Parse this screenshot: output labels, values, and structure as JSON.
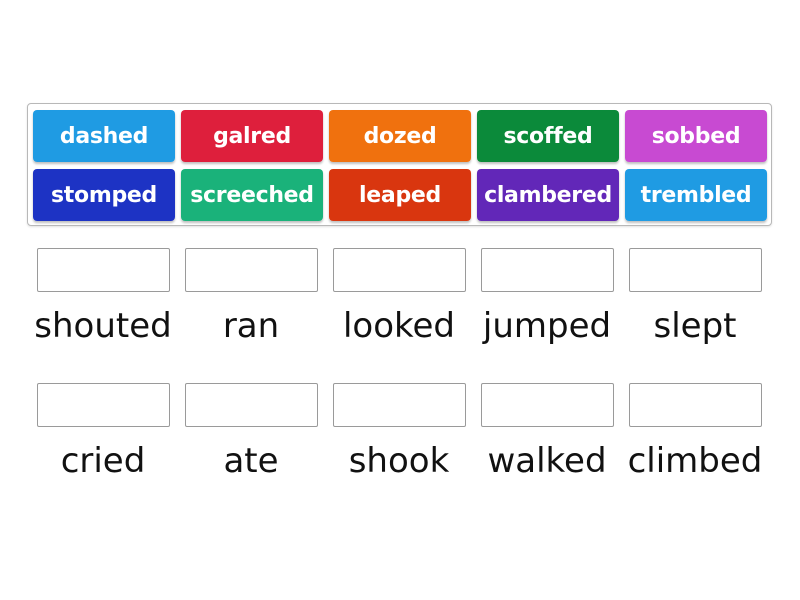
{
  "activity": {
    "tiles": [
      {
        "text": "dashed",
        "color": "#1f9be3"
      },
      {
        "text": "galred",
        "color": "#de1f3c"
      },
      {
        "text": "dozed",
        "color": "#f0710e"
      },
      {
        "text": "scoffed",
        "color": "#0b8a3a"
      },
      {
        "text": "sobbed",
        "color": "#c84ad2"
      },
      {
        "text": "stomped",
        "color": "#1d33c4"
      },
      {
        "text": "screeched",
        "color": "#1ab27a"
      },
      {
        "text": "leaped",
        "color": "#d9360f"
      },
      {
        "text": "clambered",
        "color": "#6227b8"
      },
      {
        "text": "trembled",
        "color": "#1f9be3"
      }
    ],
    "targets": [
      {
        "label": "shouted",
        "value": ""
      },
      {
        "label": "ran",
        "value": ""
      },
      {
        "label": "looked",
        "value": ""
      },
      {
        "label": "jumped",
        "value": ""
      },
      {
        "label": "slept",
        "value": ""
      },
      {
        "label": "cried",
        "value": ""
      },
      {
        "label": "ate",
        "value": ""
      },
      {
        "label": "shook",
        "value": ""
      },
      {
        "label": "walked",
        "value": ""
      },
      {
        "label": "climbed",
        "value": ""
      }
    ]
  }
}
